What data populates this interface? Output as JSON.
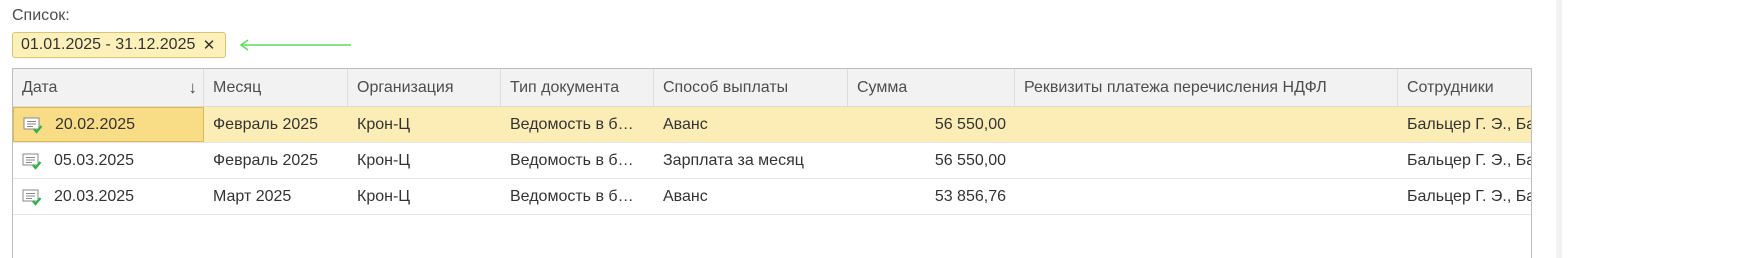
{
  "list": {
    "label": "Список:"
  },
  "filter": {
    "period": "01.01.2025 - 31.12.2025",
    "close_glyph": "✕"
  },
  "table": {
    "columns": [
      {
        "key": "date",
        "label": "Дата",
        "sort": "desc"
      },
      {
        "key": "month",
        "label": "Месяц"
      },
      {
        "key": "org",
        "label": "Организация"
      },
      {
        "key": "type",
        "label": "Тип документа"
      },
      {
        "key": "pay",
        "label": "Способ выплаты"
      },
      {
        "key": "sum",
        "label": "Сумма"
      },
      {
        "key": "req",
        "label": "Реквизиты платежа перечисления НДФЛ"
      },
      {
        "key": "emp",
        "label": "Сотрудники"
      }
    ],
    "sort_glyph": "↓",
    "rows": [
      {
        "date": "20.02.2025",
        "month": "Февраль 2025",
        "org": "Крон-Ц",
        "type": "Ведомость в б…",
        "pay": "Аванс",
        "sum": "56 550,00",
        "req": "",
        "emp": "Бальцер Г. Э., Ба",
        "selected": true,
        "icon": "posted-document-icon"
      },
      {
        "date": "05.03.2025",
        "month": "Февраль 2025",
        "org": "Крон-Ц",
        "type": "Ведомость в б…",
        "pay": "Зарплата за месяц",
        "sum": "56 550,00",
        "req": "",
        "emp": "Бальцер Г. Э., Ба",
        "selected": false,
        "icon": "posted-document-icon"
      },
      {
        "date": "20.03.2025",
        "month": "Март 2025",
        "org": "Крон-Ц",
        "type": "Ведомость в б…",
        "pay": "Аванс",
        "sum": "53 856,76",
        "req": "",
        "emp": "Бальцер Г. Э., Ба",
        "selected": false,
        "icon": "posted-document-icon"
      }
    ]
  },
  "colors": {
    "selected_row": "#fbedb5",
    "selected_cell": "#f8dc86",
    "chip_bg": "#fdf0b8",
    "annotation_arrow": "#5fdc5f",
    "posted_mark": "#2db24a"
  }
}
